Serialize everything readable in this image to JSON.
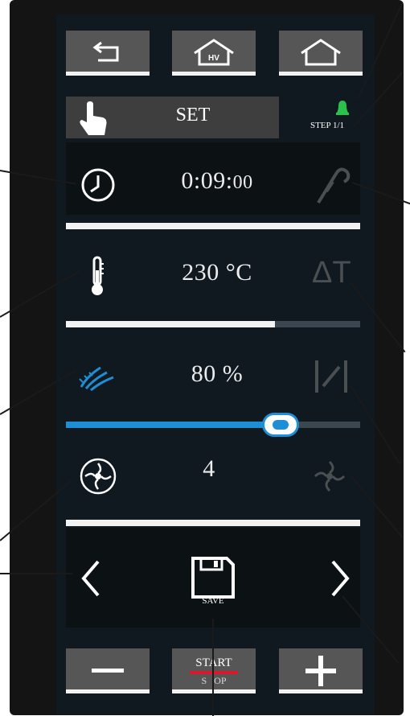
{
  "header": {
    "set_label": "SET",
    "step_label": "STEP 1/1",
    "home_label": "HV"
  },
  "params": {
    "time": {
      "main": "0:09:",
      "sub": "00"
    },
    "temperature": {
      "value": "230 °C",
      "fill_fraction": 0.71
    },
    "humidity": {
      "value": "80 %",
      "fill_fraction": 0.73
    },
    "fan_speed": {
      "value": "4"
    }
  },
  "footer": {
    "save_label": "SAVE",
    "start_label": "START",
    "stop_label": "S   OP"
  },
  "icons": {
    "back": "return-arrow-icon",
    "home_hv": "home-hv-icon",
    "home": "home-icon",
    "hand": "hand-pointer-icon",
    "bell": "bell-icon",
    "clock": "clock-icon",
    "probe": "core-probe-icon",
    "thermometer": "thermometer-icon",
    "delta_t": "delta-t-icon",
    "humidity": "steam-icon",
    "valve": "damper-valve-icon",
    "fan": "fan-icon",
    "fan_off": "fan-disabled-icon",
    "prev": "chevron-left-icon",
    "next": "chevron-right-icon",
    "save": "floppy-disk-icon"
  },
  "colors": {
    "accent_blue": "#1e8fd6",
    "bell_green": "#2bc24b",
    "stop_red": "#d9192b",
    "bar_white": "#f2f2f2",
    "bar_track": "#3a4650"
  }
}
